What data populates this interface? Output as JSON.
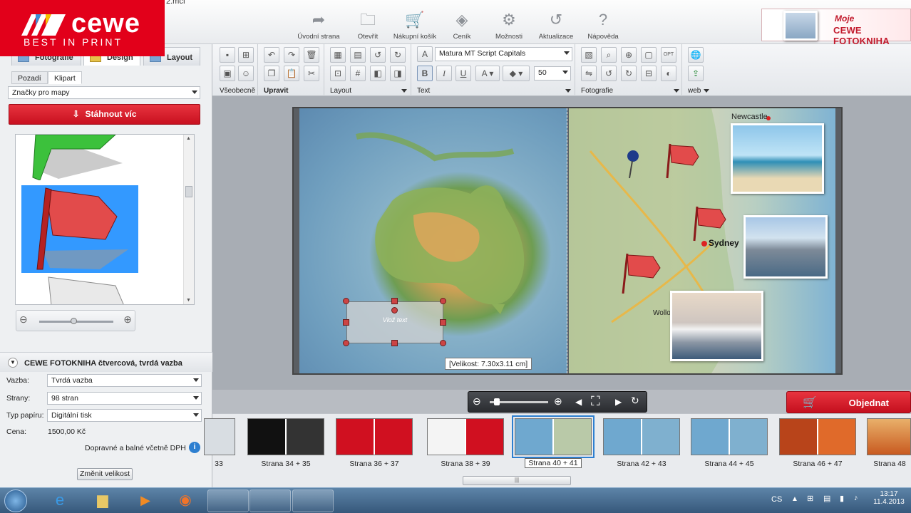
{
  "window": {
    "title_fragment": "2.mcf"
  },
  "brand": {
    "logo_text": "cewe",
    "tagline": "BEST IN PRINT",
    "promo_line1": "Moje",
    "promo_line2": "CEWE FOTOKNIHA"
  },
  "topnav": [
    {
      "label": "Úvodní strana",
      "icon": "home-arrow-icon"
    },
    {
      "label": "Otevřít",
      "icon": "open-folder-icon"
    },
    {
      "label": "Nákupní košík",
      "icon": "cart-icon"
    },
    {
      "label": "Ceník",
      "icon": "price-tag-icon"
    },
    {
      "label": "Možnosti",
      "icon": "gears-icon"
    },
    {
      "label": "Aktualizace",
      "icon": "refresh-icon"
    },
    {
      "label": "Nápověda",
      "icon": "help-icon"
    }
  ],
  "left": {
    "tabs": [
      "Fotografie",
      "Design",
      "Layout"
    ],
    "subtabs": [
      "Pozadí",
      "Klipart"
    ],
    "category": "Značky pro mapy",
    "download_label": "Stáhnout víc",
    "product_title": "CEWE FOTOKNIHA čtvercová, tvrdá vazba",
    "binding_label": "Vazba:",
    "binding_value": "Tvrdá vazba",
    "pages_label": "Strany:",
    "pages_value": "98 stran",
    "paper_label": "Typ papíru:",
    "paper_value": "Digitální tisk",
    "price_label": "Cena:",
    "price_value": "1500,00 Kč",
    "shipping_note": "Dopravné a balné včetně DPH",
    "change_size_label": "Změnit velikost"
  },
  "ribbon": {
    "groups": [
      "Všeobecně",
      "Upravit",
      "Layout",
      "Text",
      "Fotografie",
      "web"
    ],
    "font_name": "Matura MT Script Capitals",
    "font_size": "50",
    "bold": "B",
    "italic": "I",
    "underline": "U"
  },
  "canvas": {
    "size_tooltip": "[Velikost: 7.30x3.11 cm]",
    "textbox_placeholder": "Vlož text",
    "map_labels": [
      "Newcastle",
      "Sydney",
      "Wollo"
    ]
  },
  "order_label": "Objednat",
  "filmstrip": [
    {
      "label": "33",
      "theme": "#d8dde2"
    },
    {
      "label": "Strana 34 + 35",
      "theme": "#222"
    },
    {
      "label": "Strana 36 + 37",
      "theme": "#d01020"
    },
    {
      "label": "Strana 38 + 39",
      "theme": "#d01020"
    },
    {
      "label": "Strana 40 + 41",
      "theme": "#6fa8cf",
      "selected": true
    },
    {
      "label": "Strana 42 + 43",
      "theme": "#6fa8cf"
    },
    {
      "label": "Strana 44 + 45",
      "theme": "#6fa8cf"
    },
    {
      "label": "Strana 46 + 47",
      "theme": "#b8441a"
    },
    {
      "label": "Strana 48",
      "theme": "#c85a20"
    }
  ],
  "taskbar": {
    "lang": "CS",
    "time": "13:17",
    "date": "11.4.2013"
  },
  "colors": {
    "brand_red": "#e2001a",
    "selection_blue": "#3399ff",
    "taskbar": "#36587b"
  }
}
